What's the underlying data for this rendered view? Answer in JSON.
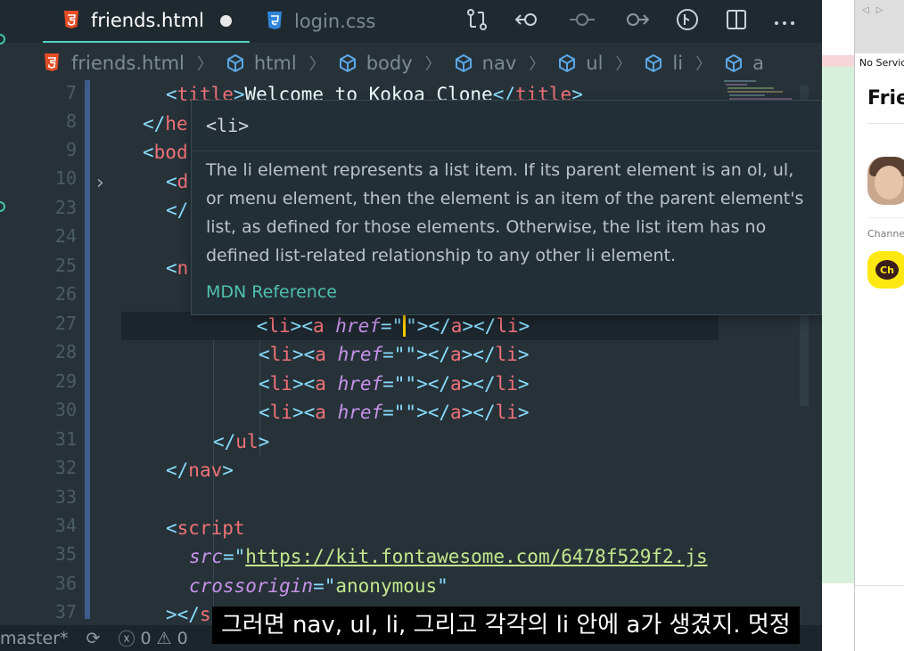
{
  "tabs": [
    {
      "label": "friends.html",
      "icon": "html5-icon",
      "dirty": true
    },
    {
      "label": "login.css",
      "icon": "css3-icon"
    }
  ],
  "toolbar": {
    "icons": [
      "source-control-compare-icon",
      "go-back-icon",
      "timeline-dot-icon",
      "go-forward-icon",
      "git-graph-icon",
      "split-editor-icon",
      "more-icon"
    ]
  },
  "breadcrumb": [
    "friends.html",
    "html",
    "body",
    "nav",
    "ul",
    "li",
    "a"
  ],
  "line_numbers": [
    "7",
    "8",
    "9",
    "10",
    "23",
    "24",
    "25",
    "26",
    "27",
    "28",
    "29",
    "30",
    "31",
    "32",
    "33",
    "34",
    "35",
    "36",
    "37"
  ],
  "code": {
    "l7_text": "Welcome to Kokoa Clone",
    "l8_partial": "he",
    "l9_partial": "bod",
    "l10_partial": "d",
    "l25_partial": "n",
    "script_src_attr": "src",
    "script_src": "https://kit.fontawesome.com/6478f529f2.js",
    "script_cross_attr": "crossorigin",
    "script_cross": "anonymous",
    "href_attr": "href"
  },
  "hover": {
    "title": "<li>",
    "description": "The li element represents a list item. If its parent element is an ol, ul, or menu element, then the element is an item of the parent element's list, as defined for those elements. Otherwise, the list item has no defined list-related relationship to any other li element.",
    "link": "MDN Reference"
  },
  "statusbar": {
    "branch": "master*",
    "errors": "0",
    "warnings": "0"
  },
  "preview": {
    "status": "No Service",
    "title": "Friends",
    "channel_label": "Channel",
    "channel_logo": "Ch"
  },
  "subtitle": "그러면 nav, ul, li, 그리고 각각의 li 안에 a가 생겼지. 멋정"
}
